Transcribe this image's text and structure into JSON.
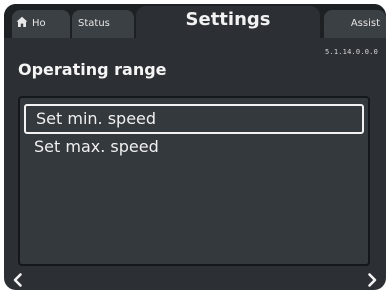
{
  "tabs": {
    "home_label": "Ho",
    "status_label": "Status",
    "settings_label": "Settings",
    "assist_label": "Assist"
  },
  "header": {
    "title": "Operating range",
    "menu_code": "5.1.14.0.0.0"
  },
  "list": {
    "items": [
      {
        "label": "Set min. speed",
        "selected": true
      },
      {
        "label": "Set max. speed",
        "selected": false
      }
    ]
  },
  "icons": {
    "home": "home-icon",
    "back": "chevron-left-icon",
    "forward": "chevron-right-icon"
  },
  "colors": {
    "background": "#2c3034",
    "tab_bar": "#1e2124",
    "inactive_tab": "#3b4045",
    "text": "#f0f0f0",
    "selection_border": "#f2f2f2"
  }
}
